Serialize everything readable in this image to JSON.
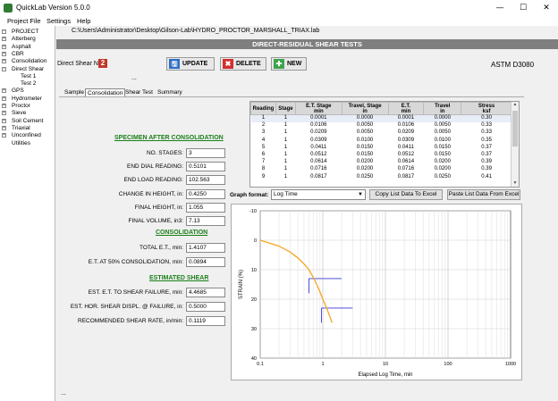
{
  "window": {
    "title": "QuickLab  Version 5.0.0",
    "minimize": "—",
    "maximize": "☐",
    "close": "✕"
  },
  "menu": [
    "Project File",
    "Settings",
    "Help"
  ],
  "tree": [
    {
      "label": "PROJECT",
      "box": "−",
      "depth": 0
    },
    {
      "label": "Atterberg",
      "box": "+",
      "depth": 0
    },
    {
      "label": "Asphalt",
      "box": "+",
      "depth": 0
    },
    {
      "label": "CBR",
      "box": "+",
      "depth": 0
    },
    {
      "label": "Consolidation",
      "box": "+",
      "depth": 0
    },
    {
      "label": "Direct Shear",
      "box": "−",
      "depth": 0
    },
    {
      "label": "Test 1",
      "box": "",
      "depth": 1
    },
    {
      "label": "Test 2",
      "box": "",
      "depth": 1
    },
    {
      "label": "GPS",
      "box": "+",
      "depth": 0
    },
    {
      "label": "Hydrometer",
      "box": "+",
      "depth": 0
    },
    {
      "label": "Proctor",
      "box": "+",
      "depth": 0
    },
    {
      "label": "Sieve",
      "box": "+",
      "depth": 0
    },
    {
      "label": "Soil Cement",
      "box": "+",
      "depth": 0
    },
    {
      "label": "Triaxial",
      "box": "+",
      "depth": 0
    },
    {
      "label": "Unconfined",
      "box": "+",
      "depth": 0
    },
    {
      "label": "Utilities",
      "box": "",
      "depth": 0
    }
  ],
  "file_path": "C:\\Users\\Administrator\\Desktop\\Gilson-Lab\\HYDRO_PROCTOR_MARSHALL_TRIAX.lab",
  "header": "DIRECT-RESIDUAL SHEAR TESTS",
  "direct_shear": {
    "label": "Direct Shear No.",
    "number": "2"
  },
  "toolbar": {
    "update": "UPDATE",
    "delete": "DELETE",
    "new": "NEW",
    "update_icon": "🖫",
    "delete_icon": "✖",
    "new_icon": "✚"
  },
  "standard": "ASTM D3080",
  "ellipsis": "...",
  "tabs": [
    "Sample",
    "Consolidation",
    "Shear Test",
    "Summary"
  ],
  "specimen": {
    "heading": "SPECIMEN AFTER CONSOLIDATION",
    "fields": [
      {
        "label": "NO. STAGES:",
        "value": "3"
      },
      {
        "label": "END DIAL READING:",
        "value": "0.5101"
      },
      {
        "label": "END LOAD READING:",
        "value": "102.563"
      },
      {
        "label": "CHANGE IN HEIGHT, in:",
        "value": "0.4250"
      },
      {
        "label": "FINAL HEIGHT, in:",
        "value": "1.055"
      },
      {
        "label": "FINAL VOLUME, in3:",
        "value": "7.13"
      }
    ]
  },
  "consolidation": {
    "heading": "CONSOLIDATION",
    "fields": [
      {
        "label": "TOTAL E.T., min:",
        "value": "1.4107"
      },
      {
        "label": "E.T. AT 50% CONSOLIDATION, min:",
        "value": "0.0894"
      }
    ]
  },
  "estimated": {
    "heading": "ESTIMATED SHEAR",
    "fields": [
      {
        "label": "EST. E.T. TO SHEAR FAILURE, min:",
        "value": "4.4685"
      },
      {
        "label": "EST. HOR. SHEAR DISPL. @ FAILURE, in:",
        "value": "0.5000"
      },
      {
        "label": "RECOMMENDED SHEAR RATE, in/min:",
        "value": "0.1119"
      }
    ]
  },
  "table": {
    "headers": [
      [
        "Reading",
        ""
      ],
      [
        "Stage",
        ""
      ],
      [
        "E.T. Stage",
        "min"
      ],
      [
        "Travel, Stage",
        "in"
      ],
      [
        "E.T.",
        "min"
      ],
      [
        "Travel",
        "in"
      ],
      [
        "Stress",
        "ksf"
      ]
    ],
    "rows": [
      [
        "1",
        "1",
        "0.0001",
        "0.0000",
        "0.0001",
        "0.0000",
        "0.30"
      ],
      [
        "2",
        "1",
        "0.0106",
        "0.0050",
        "0.0106",
        "0.0050",
        "0.33"
      ],
      [
        "3",
        "1",
        "0.0209",
        "0.0050",
        "0.0209",
        "0.0050",
        "0.33"
      ],
      [
        "4",
        "1",
        "0.0309",
        "0.0100",
        "0.0309",
        "0.0100",
        "0.35"
      ],
      [
        "5",
        "1",
        "0.0411",
        "0.0150",
        "0.0411",
        "0.0150",
        "0.37"
      ],
      [
        "6",
        "1",
        "0.0512",
        "0.0150",
        "0.0512",
        "0.0150",
        "0.37"
      ],
      [
        "7",
        "1",
        "0.0614",
        "0.0200",
        "0.0614",
        "0.0200",
        "0.39"
      ],
      [
        "8",
        "1",
        "0.0716",
        "0.0200",
        "0.0716",
        "0.0200",
        "0.39"
      ],
      [
        "9",
        "1",
        "0.0817",
        "0.0250",
        "0.0817",
        "0.0250",
        "0.41"
      ]
    ]
  },
  "graph_format": {
    "label": "Graph format:",
    "value": "Log Time"
  },
  "buttons": {
    "copy": "Copy List Data To Excel",
    "paste": "Paste List Data From Excel"
  },
  "chart_data": {
    "type": "line",
    "xlabel": "Elapsed Log Time, min",
    "ylabel": "STRAIN (%)",
    "xscale": "log",
    "xlim": [
      0.1,
      1000
    ],
    "ylim": [
      -10,
      40
    ],
    "y_inverted": true,
    "xticks": [
      "0.1",
      "1",
      "10",
      "100",
      "1000"
    ],
    "yticks": [
      "-10",
      "0",
      "10",
      "20",
      "30",
      "40"
    ],
    "grid": true,
    "series": [
      {
        "color": "#f5a623",
        "x": [
          0.1,
          0.2,
          0.3,
          0.4,
          0.5,
          0.6,
          0.7,
          0.8,
          0.9,
          1.0,
          1.1,
          1.2,
          1.3,
          1.41
        ],
        "y": [
          0,
          2.0,
          4.0,
          6.0,
          8.0,
          10.0,
          12.5,
          15.0,
          17.5,
          20.0,
          22.0,
          24.0,
          26.0,
          28.0
        ]
      }
    ],
    "construction_lines": {
      "color": "#3a3ad6",
      "segments": [
        {
          "x": [
            0.6,
            2.0
          ],
          "y": [
            13,
            13
          ]
        },
        {
          "x": [
            0.6,
            0.6
          ],
          "y": [
            13,
            18
          ]
        },
        {
          "x": [
            0.95,
            3.0
          ],
          "y": [
            23,
            23
          ]
        },
        {
          "x": [
            0.95,
            0.95
          ],
          "y": [
            23,
            28
          ]
        }
      ]
    }
  }
}
